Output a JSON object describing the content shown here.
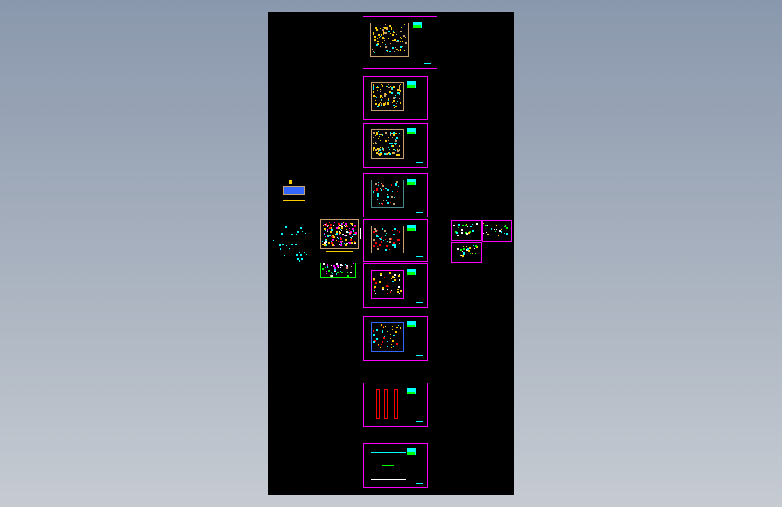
{
  "viewer": {
    "background_top": "#8a98ad",
    "background_bottom": "#c6cbd2",
    "canvas_color": "#000000"
  },
  "colors": {
    "frame": "#ff00ff",
    "cyan": "#00ffff",
    "yellow": "#ffcc00",
    "green": "#00ff00",
    "red": "#ff0000",
    "blue": "#3366ff",
    "tan": "#c8a070",
    "white": "#ffffff"
  }
}
